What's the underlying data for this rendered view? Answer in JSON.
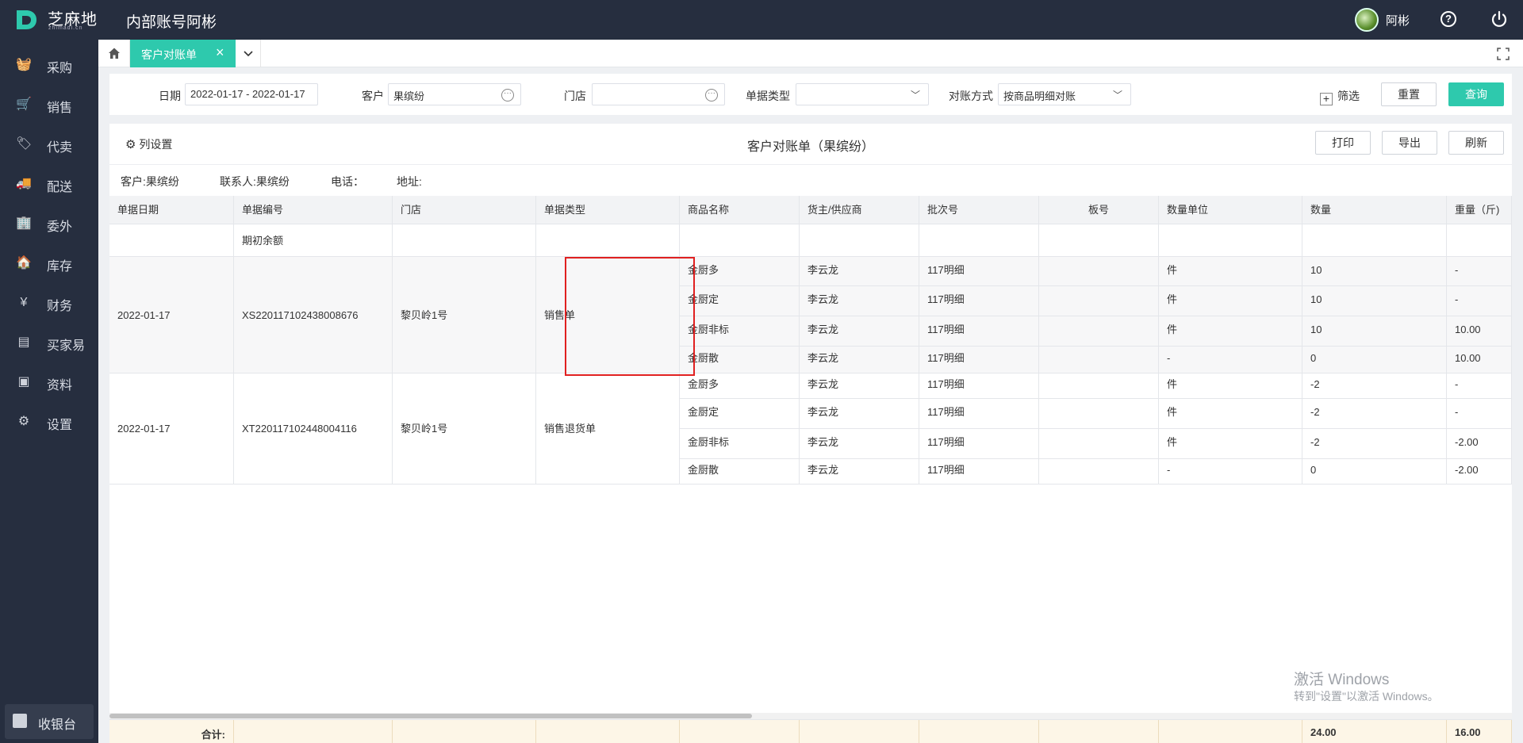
{
  "app": {
    "logo_text": "芝麻地",
    "logo_sub": "zhimadi.cn",
    "account": "内部账号阿彬",
    "username": "阿彬"
  },
  "sidebar": {
    "items": [
      {
        "label": "采购",
        "icon": "basket-icon",
        "glyph": "🧺"
      },
      {
        "label": "销售",
        "icon": "cart-icon",
        "glyph": "🛒"
      },
      {
        "label": "代卖",
        "icon": "tag-icon",
        "glyph": "🏷"
      },
      {
        "label": "配送",
        "icon": "truck-icon",
        "glyph": "🚚"
      },
      {
        "label": "委外",
        "icon": "building-icon",
        "glyph": "🏢"
      },
      {
        "label": "库存",
        "icon": "warehouse-icon",
        "glyph": "🏠"
      },
      {
        "label": "财务",
        "icon": "finance-icon",
        "glyph": "¥"
      },
      {
        "label": "买家易",
        "icon": "store-icon",
        "glyph": "▤"
      },
      {
        "label": "资料",
        "icon": "printer-icon",
        "glyph": "▣"
      },
      {
        "label": "设置",
        "icon": "gear-icon",
        "glyph": "⚙"
      }
    ],
    "cashier": "收银台"
  },
  "tabs": {
    "active": "客户对账单"
  },
  "filters": {
    "date_label": "日期",
    "date_value": "2022-01-17 - 2022-01-17",
    "customer_label": "客户",
    "customer_value": "果缤纷",
    "store_label": "门店",
    "store_value": "",
    "doctype_label": "单据类型",
    "doctype_value": "",
    "method_label": "对账方式",
    "method_value": "按商品明细对账",
    "filter_label": "筛选",
    "reset_label": "重置",
    "query_label": "查询"
  },
  "panel": {
    "colset_label": "列设置",
    "title": "客户对账单（果缤纷）",
    "print_label": "打印",
    "export_label": "导出",
    "refresh_label": "刷新",
    "info": {
      "customer": "客户:果缤纷",
      "contact": "联系人:果缤纷",
      "phone": "电话：",
      "address": "地址:"
    }
  },
  "table": {
    "headers": [
      "单据日期",
      "单据编号",
      "门店",
      "单据类型",
      "商品名称",
      "货主/供应商",
      "批次号",
      "板号",
      "数量单位",
      "数量",
      "重量（斤)"
    ],
    "opening_balance": "期初余额",
    "documents": [
      {
        "date": "2022-01-17",
        "number": "XS220117102438008676",
        "store": "黎贝岭1号",
        "type": "销售单",
        "items": [
          {
            "product": "金厨多",
            "supplier": "李云龙",
            "batch": "117明细",
            "board": "",
            "unit": "件",
            "qty": "10",
            "weight": "-"
          },
          {
            "product": "金厨定",
            "supplier": "李云龙",
            "batch": "117明细",
            "board": "",
            "unit": "件",
            "qty": "10",
            "weight": "-"
          },
          {
            "product": "金厨非标",
            "supplier": "李云龙",
            "batch": "117明细",
            "board": "",
            "unit": "件",
            "qty": "10",
            "weight": "10.00"
          },
          {
            "product": "金厨散",
            "supplier": "李云龙",
            "batch": "117明细",
            "board": "",
            "unit": "-",
            "qty": "0",
            "weight": "10.00"
          }
        ]
      },
      {
        "date": "2022-01-17",
        "number": "XT220117102448004116",
        "store": "黎贝岭1号",
        "type": "销售退货单",
        "items": [
          {
            "product": "金厨多",
            "supplier": "李云龙",
            "batch": "117明细",
            "board": "",
            "unit": "件",
            "qty": "-2",
            "weight": "-"
          },
          {
            "product": "金厨定",
            "supplier": "李云龙",
            "batch": "117明细",
            "board": "",
            "unit": "件",
            "qty": "-2",
            "weight": "-"
          },
          {
            "product": "金厨非标",
            "supplier": "李云龙",
            "batch": "117明细",
            "board": "",
            "unit": "件",
            "qty": "-2",
            "weight": "-2.00"
          },
          {
            "product": "金厨散",
            "supplier": "李云龙",
            "batch": "117明细",
            "board": "",
            "unit": "-",
            "qty": "0",
            "weight": "-2.00"
          }
        ]
      }
    ],
    "total_label": "合计:",
    "total_qty": "24.00",
    "total_weight": "16.00"
  },
  "watermark": {
    "line1": "激活 Windows",
    "line2": "转到\"设置\"以激活 Windows。"
  },
  "colors": {
    "sidebar_bg": "#262e3f",
    "accent": "#2ec9ad",
    "highlight": "#e02020",
    "total_bg": "#fdf6e7"
  }
}
